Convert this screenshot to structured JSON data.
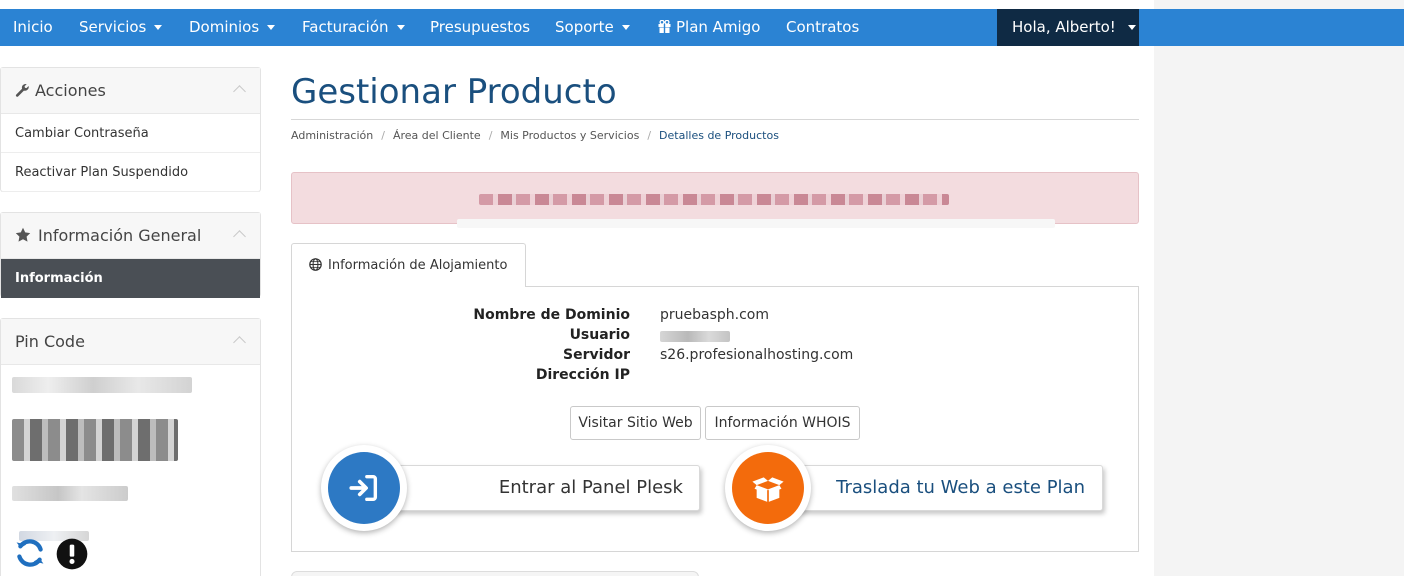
{
  "nav": {
    "items": [
      {
        "label": "Inicio",
        "dropdown": false
      },
      {
        "label": "Servicios",
        "dropdown": true
      },
      {
        "label": "Dominios",
        "dropdown": true
      },
      {
        "label": "Facturación",
        "dropdown": true
      },
      {
        "label": "Presupuestos",
        "dropdown": false
      },
      {
        "label": "Soporte",
        "dropdown": true
      },
      {
        "label": "Plan Amigo",
        "dropdown": false,
        "icon": "gift-icon"
      },
      {
        "label": "Contratos",
        "dropdown": false
      }
    ],
    "user_label": "Hola, Alberto!"
  },
  "sidebar": {
    "acciones": {
      "title": "Acciones",
      "icon": "wrench-icon",
      "links": [
        "Cambiar Contraseña",
        "Reactivar Plan Suspendido"
      ]
    },
    "info": {
      "title": "Información General",
      "icon": "star-icon",
      "links": [
        "Información"
      ]
    },
    "pin": {
      "title": "Pin Code",
      "icons": [
        "refresh-icon",
        "alert-icon"
      ]
    }
  },
  "main": {
    "title": "Gestionar Producto",
    "breadcrumb": [
      "Administración",
      "Área del Cliente",
      "Mis Productos y Servicios",
      "Detalles de Productos"
    ],
    "tab_label": "Información de Alojamiento",
    "fields": {
      "domain_label": "Nombre de Dominio",
      "domain_value": "pruebasph.com",
      "user_label": "Usuario",
      "server_label": "Servidor",
      "server_value": "s26.profesionalhosting.com",
      "ip_label": "Dirección IP"
    },
    "buttons": {
      "visit": "Visitar Sitio Web",
      "whois": "Información WHOIS",
      "plesk": "Entrar al Panel Plesk",
      "migrate": "Traslada tu Web a este Plan"
    }
  },
  "colors": {
    "nav": "#2b83d3",
    "user_menu": "#0f2a44",
    "title": "#1a4f7e",
    "plesk_circle": "#2d79c4",
    "migrate_circle": "#f36b0c",
    "alert_bg": "#f3dcdf"
  }
}
